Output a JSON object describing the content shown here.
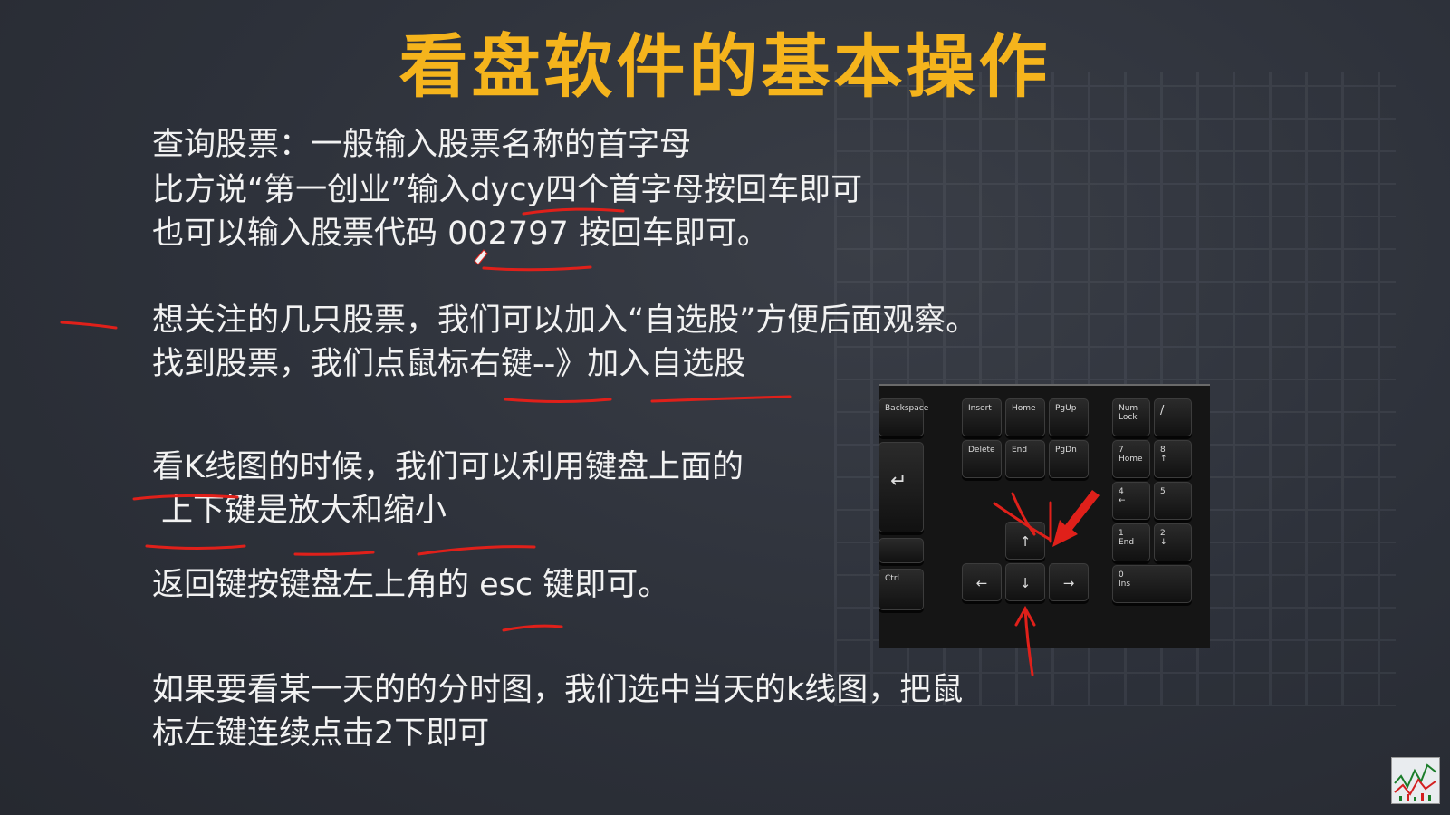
{
  "title": "看盘软件的基本操作",
  "lines": {
    "l1": "查询股票：一般输入股票名称的首字母",
    "l2": "比方说“第一创业”输入dycy四个首字母按回车即可",
    "l3": "也可以输入股票代码 002797 按回车即可。",
    "l4": "想关注的几只股票，我们可以加入“自选股”方便后面观察。",
    "l5": "找到股票，我们点鼠标右键--》加入自选股",
    "l6": "看K线图的时候，我们可以利用键盘上面的",
    "l7": "上下键是放大和缩小",
    "l8": "返回键按键盘左上角的 esc 键即可。",
    "l9": "如果要看某一天的的分时图，我们选中当天的k线图，把鼠",
    "l10": "标左键连续点击2下即可"
  },
  "keys": {
    "backspace": "Backspace",
    "insert": "Insert",
    "home": "Home",
    "pgup": "PgUp",
    "delete": "Delete",
    "end": "End",
    "pgdn": "PgDn",
    "num": "Num",
    "lock": "Lock",
    "slash": "/",
    "n7": "7",
    "n7sub": "Home",
    "n8": "8",
    "n8sub": "↑",
    "n4": "4",
    "n4sub": "←",
    "n5": "5",
    "n1": "1",
    "n1sub": "End",
    "n2": "2",
    "n2sub": "↓",
    "n0": "0",
    "n0sub": "Ins",
    "ctrl": "Ctrl",
    "enter": "↵",
    "up": "↑",
    "down": "↓",
    "left": "←",
    "right": "→"
  },
  "colors": {
    "title": "#f5b41c",
    "text": "#f2f2f2",
    "ink": "#e0201a",
    "background": "#2d313a"
  }
}
